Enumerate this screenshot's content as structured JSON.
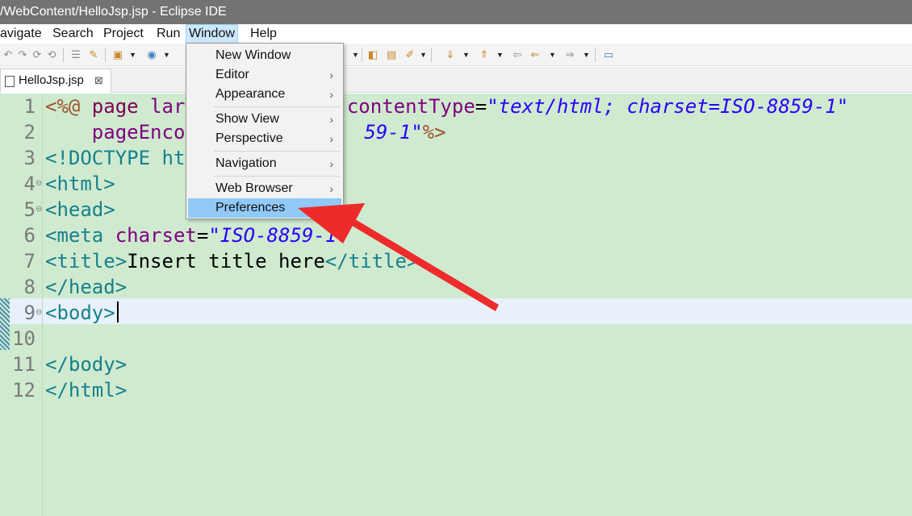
{
  "window": {
    "title": "/WebContent/HelloJsp.jsp - Eclipse IDE"
  },
  "menubar": {
    "items": [
      "avigate",
      "Search",
      "Project",
      "Run",
      "Window",
      "Help"
    ],
    "active": "Window"
  },
  "tab": {
    "label": "HelloJsp.jsp",
    "close": "⊠"
  },
  "editor": {
    "line_numbers": [
      "1",
      "2",
      "3",
      "4",
      "5",
      "6",
      "7",
      "8",
      "9",
      "10",
      "11",
      "12"
    ],
    "fold_markers": {
      "4": "⊖",
      "5": "⊖",
      "9": "⊖"
    },
    "lines": [
      {
        "l1a": "<%@ ",
        "l1b": "page",
        "l1c": " lar",
        "l1d": " contentType",
        "l1e": "=",
        "l1f": "\"text/html; charset=ISO-8859-1\""
      },
      {
        "l2a": "    pageEnco",
        "l2b": "59-1\"",
        "l2c": "%>"
      },
      {
        "l3a": "<!DOCTYPE ht"
      },
      {
        "l4a": "<html>"
      },
      {
        "l5a": "<head>"
      },
      {
        "l6a": "<meta ",
        "l6b": "charset",
        "l6c": "=",
        "l6d": "\"ISO-8859-1\""
      },
      {
        "l7a": "<title>",
        "l7b": "Insert title here",
        "l7c": "</title>"
      },
      {
        "l8a": "</head>"
      },
      {
        "l9a": "<body>"
      },
      {
        "l10a": ""
      },
      {
        "l11a": "</body>"
      },
      {
        "l12a": "</html>"
      }
    ]
  },
  "window_menu": {
    "items": [
      {
        "label": "New Window",
        "submenu": false
      },
      {
        "label": "Editor",
        "submenu": true
      },
      {
        "label": "Appearance",
        "submenu": true
      },
      {
        "label": "Show View",
        "submenu": true
      },
      {
        "label": "Perspective",
        "submenu": true
      },
      {
        "label": "Navigation",
        "submenu": true
      },
      {
        "label": "Web Browser",
        "submenu": true
      },
      {
        "label": "Preferences",
        "submenu": false,
        "highlighted": true
      }
    ],
    "submenu_arrow": "›"
  },
  "colors": {
    "editor_background": "#cfeacf",
    "highlight": "#91c9f7",
    "annotation_arrow": "#ee2b2b"
  }
}
